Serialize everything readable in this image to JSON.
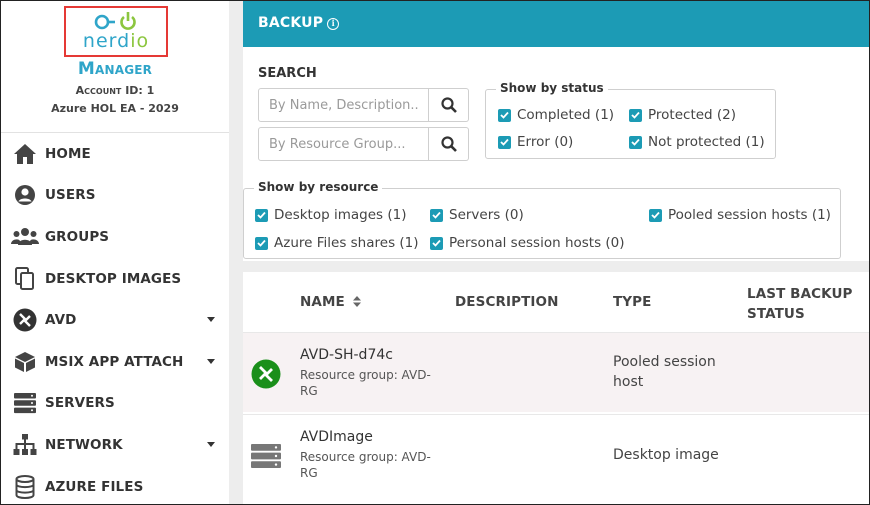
{
  "brand": {
    "logo_text_main": "nerd",
    "logo_text_accent": "io",
    "product": "Manager",
    "account_id": "Account ID: 1",
    "tenant": "Azure HOL EA - 2029"
  },
  "colors": {
    "primary": "#1c9bb5",
    "logo_blue": "#2fa5c9",
    "logo_green": "#8cc63f",
    "highlight_border": "#e53935",
    "avd_green": "#1a8f1a"
  },
  "sidebar": {
    "items": [
      {
        "label": "HOME",
        "icon": "home-icon",
        "has_caret": false
      },
      {
        "label": "USERS",
        "icon": "user-icon",
        "has_caret": false
      },
      {
        "label": "GROUPS",
        "icon": "users-group-icon",
        "has_caret": false
      },
      {
        "label": "DESKTOP IMAGES",
        "icon": "copy-icon",
        "has_caret": false
      },
      {
        "label": "AVD",
        "icon": "avd-icon",
        "has_caret": true
      },
      {
        "label": "MSIX APP ATTACH",
        "icon": "package-icon",
        "has_caret": true
      },
      {
        "label": "SERVERS",
        "icon": "server-icon",
        "has_caret": false
      },
      {
        "label": "NETWORK",
        "icon": "network-icon",
        "has_caret": true
      },
      {
        "label": "AZURE FILES",
        "icon": "database-icon",
        "has_caret": false
      }
    ]
  },
  "header": {
    "title": "BACKUP",
    "info_icon": "info-icon"
  },
  "search": {
    "title": "SEARCH",
    "name_placeholder": "By Name, Description...",
    "rg_placeholder": "By Resource Group...",
    "button_icon": "search-icon"
  },
  "status_filter": {
    "legend": "Show by status",
    "options": [
      {
        "label": "Completed (1)",
        "checked": true
      },
      {
        "label": "Protected (2)",
        "checked": true
      },
      {
        "label": "Error (0)",
        "checked": true
      },
      {
        "label": "Not protected (1)",
        "checked": true
      }
    ]
  },
  "resource_filter": {
    "legend": "Show by resource",
    "options": [
      {
        "label": "Desktop images (1)",
        "checked": true
      },
      {
        "label": "Servers (0)",
        "checked": true
      },
      {
        "label": "Pooled session hosts (1)",
        "checked": true
      },
      {
        "label": "Azure Files shares (1)",
        "checked": true
      },
      {
        "label": "Personal session hosts (0)",
        "checked": true
      }
    ]
  },
  "table": {
    "columns": [
      "NAME",
      "DESCRIPTION",
      "TYPE",
      "LAST BACKUP STATUS"
    ],
    "sort_icon": "sort-icon",
    "rows": [
      {
        "icon": "avd-icon",
        "name": "AVD-SH-d74c",
        "resource_group": "Resource group: AVD-RG",
        "description": "",
        "type": "Pooled session host",
        "last_backup_status": ""
      },
      {
        "icon": "server-icon",
        "name": "AVDImage",
        "resource_group": "Resource group: AVD-RG",
        "description": "",
        "type": "Desktop image",
        "last_backup_status": ""
      }
    ]
  }
}
